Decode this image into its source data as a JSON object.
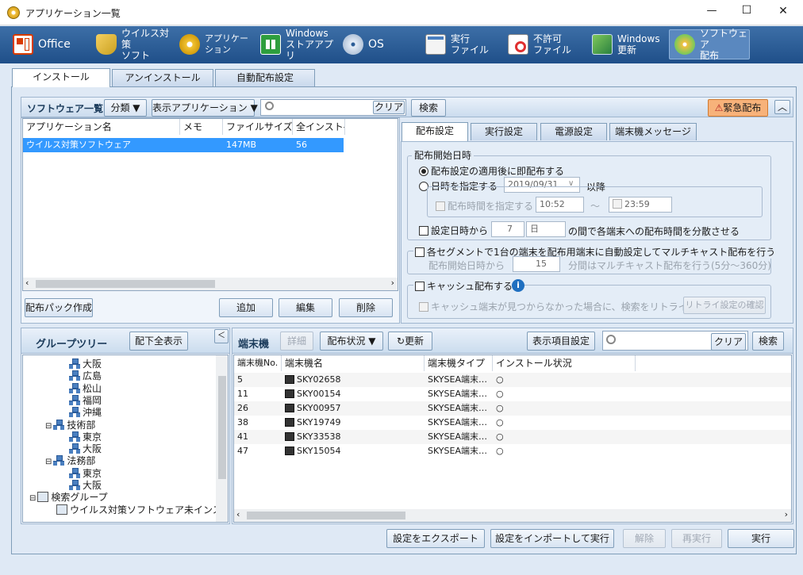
{
  "window": {
    "title": "アプリケーション一覧",
    "min": "—",
    "max": "☐",
    "close": "✕"
  },
  "toolbar": {
    "items": [
      {
        "label": "Office",
        "icon": "office-icon"
      },
      {
        "label": "ウイルス対策\nソフト",
        "icon": "antivirus-icon"
      },
      {
        "label": "アプリケーション",
        "icon": "application-icon"
      },
      {
        "label": "Windows\nストアアプリ",
        "icon": "windows-store-icon"
      },
      {
        "label": "OS",
        "icon": "os-disc-icon"
      },
      {
        "label": "実行\nファイル",
        "icon": "executable-icon"
      },
      {
        "label": "不許可\nファイル",
        "icon": "forbidden-file-icon"
      },
      {
        "label": "Windows\n更新",
        "icon": "windows-update-icon"
      },
      {
        "label": "ソフトウェア\n配布",
        "icon": "software-distribution-icon"
      }
    ]
  },
  "main_tabs": [
    "インストール",
    "アンインストール",
    "自動配布設定"
  ],
  "software": {
    "title": "ソフトウェア一覧",
    "category": "分類 ▼",
    "display_apps": "表示アプリケーション ▼",
    "search_placeholder": "",
    "clear": "クリア",
    "search": "検索",
    "emergency": "緊急配布",
    "collapse": "︿",
    "columns": [
      "アプリケーション名",
      "メモ",
      "ファイルサイズ",
      "全インスト-"
    ],
    "rows": [
      {
        "name": "ウイルス対策ソフトウェア",
        "memo": "",
        "size": "147MB",
        "total": "56"
      }
    ],
    "create_pack": "配布パック作成",
    "add": "追加",
    "edit": "編集",
    "delete": "削除"
  },
  "dist_tabs": [
    "配布設定",
    "実行設定",
    "電源設定",
    "端末機メッセージ"
  ],
  "dist": {
    "start_legend": "配布開始日時",
    "immediate": "配布設定の適用後に即配布する",
    "specify_date": "日時を指定する",
    "date_value": "2019/09/31",
    "after": "以降",
    "specify_time": "配布時間を指定する",
    "time_from": "10:52",
    "tilde": "〜",
    "time_to": "23:59",
    "spread_label": "設定日時から",
    "spread_num": "7",
    "spread_unit": "日",
    "spread_suffix": "の間で各端末への配布時間を分散させる",
    "multicast_label": "各セグメントで1台の端末を配布用端末に自動設定してマルチキャスト配布を行う",
    "multicast_start": "配布開始日時から",
    "multicast_num": "15",
    "multicast_suffix": "分間はマルチキャスト配布を行う(5分〜360分)",
    "cache_label": "キャッシュ配布する",
    "cache_info": "i",
    "retry_label": "キャッシュ端末が見つからなかった場合に、検索をリトライする",
    "retry_btn": "リトライ設定の確認"
  },
  "group": {
    "title": "グループツリー",
    "show_all": "配下全表示",
    "collapse": "＜",
    "tree": [
      {
        "label": "大阪",
        "indent": 3
      },
      {
        "label": "広島",
        "indent": 3
      },
      {
        "label": "松山",
        "indent": 3
      },
      {
        "label": "福岡",
        "indent": 3
      },
      {
        "label": "沖縄",
        "indent": 3
      },
      {
        "label": "技術部",
        "indent": 2,
        "expander": "⊟"
      },
      {
        "label": "東京",
        "indent": 3
      },
      {
        "label": "大阪",
        "indent": 3
      },
      {
        "label": "法務部",
        "indent": 2,
        "expander": "⊟"
      },
      {
        "label": "東京",
        "indent": 3
      },
      {
        "label": "大阪",
        "indent": 3
      },
      {
        "label": "検索グループ",
        "indent": 0,
        "expander": "⊟",
        "search": true
      },
      {
        "label": "ウイルス対策ソフトウェア未インス…",
        "indent": 1,
        "search": true
      }
    ]
  },
  "terminal": {
    "title": "端末機",
    "detail": "詳細",
    "status": "配布状況 ▼",
    "refresh": "更新",
    "columns_btn": "表示項目設定",
    "clear": "クリア",
    "search": "検索",
    "columns": [
      "端末機No.",
      "端末機名",
      "端末機タイプ",
      "インストール状況"
    ],
    "rows": [
      {
        "no": "5",
        "name": "SKY02658",
        "type": "SKYSEA端末…",
        "status": "○"
      },
      {
        "no": "11",
        "name": "SKY00154",
        "type": "SKYSEA端末…",
        "status": "○"
      },
      {
        "no": "26",
        "name": "SKY00957",
        "type": "SKYSEA端末…",
        "status": "○"
      },
      {
        "no": "38",
        "name": "SKY19749",
        "type": "SKYSEA端末…",
        "status": "○"
      },
      {
        "no": "41",
        "name": "SKY33538",
        "type": "SKYSEA端末…",
        "status": "○"
      },
      {
        "no": "47",
        "name": "SKY15054",
        "type": "SKYSEA端末…",
        "status": "○"
      }
    ]
  },
  "footer": {
    "export": "設定をエクスポート",
    "import_run": "設定をインポートして実行",
    "release": "解除",
    "rerun": "再実行",
    "run": "実行"
  },
  "colors": {
    "toolbar": "#2a5c96",
    "selection": "#3399ff",
    "emergency": "#f7b27a"
  }
}
